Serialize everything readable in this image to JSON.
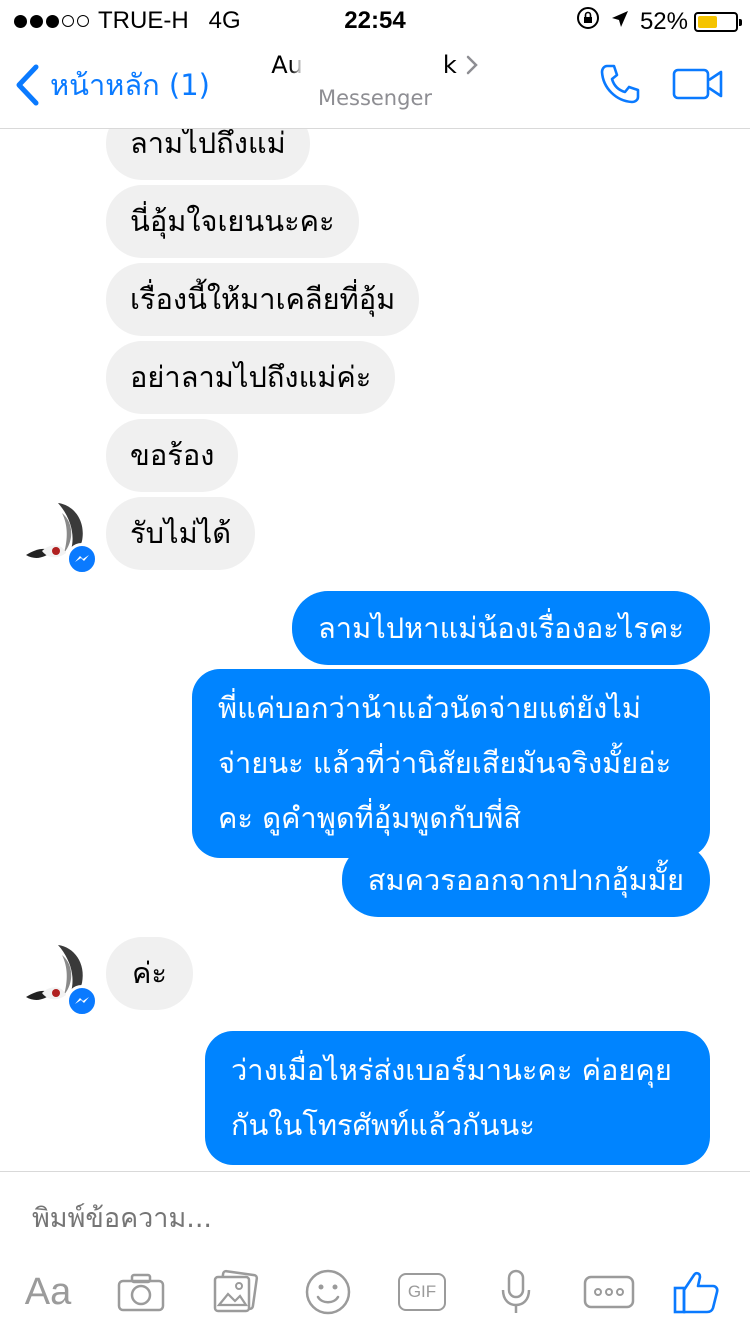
{
  "status_bar": {
    "carrier": "TRUE-H",
    "network": "4G",
    "time": "22:54",
    "battery_percent": "52%",
    "battery_level": 0.52,
    "battery_color": "#f5c400"
  },
  "header": {
    "back_label": "หน้าหลัก (1)",
    "contact_name_start": "Au",
    "contact_name_end": "k",
    "subtitle": "Messenger"
  },
  "messages": [
    {
      "side": "in",
      "text": "ลามไปถึงแม่"
    },
    {
      "side": "in",
      "text": "นี่อุ้มใจเยนนะคะ"
    },
    {
      "side": "in",
      "text": "เรื่องนี้ให้มาเคลียที่อุ้ม"
    },
    {
      "side": "in",
      "text": "อย่าลามไปถึงแม่ค่ะ"
    },
    {
      "side": "in",
      "text": "ขอร้อง"
    },
    {
      "side": "in",
      "text": "รับไม่ได้"
    },
    {
      "side": "out",
      "text": "ลามไปหาแม่น้องเรื่องอะไรคะ"
    },
    {
      "side": "out",
      "lines": [
        "พี่แค่บอกว่าน้าแอ๋วนัดจ่ายแต่ยังไม่",
        "จ่ายนะ แล้วที่ว่านิสัยเสียมันจริงมั้ยอ่ะ",
        "คะ ดูคำพูดที่อุ้มพูดกับพี่สิ"
      ]
    },
    {
      "side": "out",
      "text": "สมควรออกจากปากอุ้มมั้ย"
    },
    {
      "side": "in",
      "text": "ค่ะ"
    },
    {
      "side": "out",
      "lines": [
        "ว่างเมื่อไหร่ส่งเบอร์มานะคะ ค่อยคุย",
        "กันในโทรศัพท์แล้วกันนะ"
      ]
    }
  ],
  "composer": {
    "placeholder": "พิมพ์ข้อความ...",
    "aa_label": "Aa",
    "gif_label": "GIF"
  },
  "colors": {
    "accent": "#0a7aff",
    "outgoing_bubble": "#0084ff",
    "incoming_bubble": "#f0f0f0"
  }
}
